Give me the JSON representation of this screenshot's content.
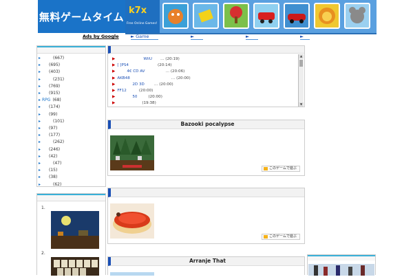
{
  "header": {
    "logo_text": "無料ゲームタイム",
    "banner_brand": "k7x",
    "banner_tagline": "Free Online Games!",
    "banner_games": [
      "orange creature game",
      "yellow block game",
      "apple tree game",
      "red car game",
      "cars racing game",
      "lion game",
      "mouse game"
    ]
  },
  "nav": {
    "ads_label": "Ads by Google",
    "links": [
      "► Game",
      "►",
      "►",
      "►"
    ]
  },
  "sidebar": {
    "categories": [
      {
        "name": "",
        "count": "(667)"
      },
      {
        "name": "",
        "count": "(695)"
      },
      {
        "name": "",
        "count": "(403)"
      },
      {
        "name": "",
        "count": "(231)"
      },
      {
        "name": "",
        "count": "(769)"
      },
      {
        "name": "",
        "count": "(915)"
      },
      {
        "name": "RPG",
        "count": "(68)"
      },
      {
        "name": "",
        "count": "(174)"
      },
      {
        "name": "",
        "count": "(99)"
      },
      {
        "name": "",
        "count": "(101)"
      },
      {
        "name": "",
        "count": "(97)"
      },
      {
        "name": "",
        "count": "(177)"
      },
      {
        "name": "",
        "count": "(262)"
      },
      {
        "name": "",
        "count": "(246)"
      },
      {
        "name": "",
        "count": "(42)"
      },
      {
        "name": "",
        "count": "(47)"
      },
      {
        "name": "",
        "count": "(15)"
      },
      {
        "name": "",
        "count": "(38)"
      },
      {
        "name": "",
        "count": "(62)"
      }
    ]
  },
  "ranking": {
    "items": [
      "1.",
      "2."
    ]
  },
  "news": {
    "items": [
      {
        "link": "WiiU",
        "tail": "… (20:19)"
      },
      {
        "link": "[ ]PS4",
        "tail": "(20:14)"
      },
      {
        "link": "4€    CD      AV",
        "tail": "… (20:06)"
      },
      {
        "link": "AKB48",
        "tail": "… (20:00)"
      },
      {
        "link": "2D   3D",
        "tail": "… (20:00)"
      },
      {
        "link": "FF12",
        "tail": "(20:00)"
      },
      {
        "link": "50",
        "tail": "(20:00)"
      },
      {
        "link": "",
        "tail": "(19:38)"
      }
    ]
  },
  "games": [
    {
      "title": "Bazooki pocalypse",
      "play_label": "このゲームで遊ぶ"
    },
    {
      "title": "",
      "play_label": "このゲームで遊ぶ"
    },
    {
      "title": "Arranje That",
      "play_label": ""
    }
  ],
  "colors": {
    "brand_blue": "#1a73c8",
    "accent_cyan": "#39b0d8",
    "news_arrow": "#cc0000"
  }
}
